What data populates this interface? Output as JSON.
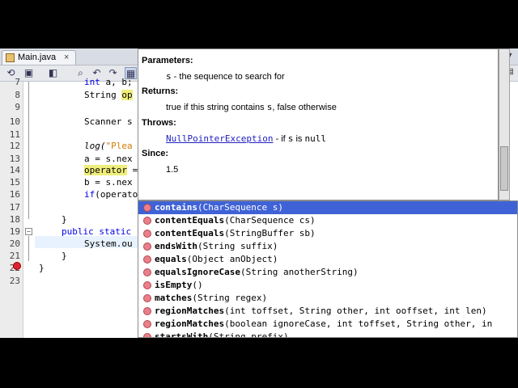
{
  "tab": {
    "label": "Main.java",
    "close": "×"
  },
  "scroll_controls": {
    "tab_list": "▾",
    "editor_split": "▤"
  },
  "toolbar_icons": [
    "history-icon",
    "source-icon",
    "back-icon",
    "forward-icon",
    "search-icon",
    "prev-icon",
    "next-icon",
    "toggle-icon"
  ],
  "gutter": {
    "line_numbers": [
      "7",
      "8",
      "9",
      "10",
      "11",
      "12",
      "13",
      "14",
      "15",
      "16",
      "17",
      "18",
      "19",
      "20",
      "21",
      "22",
      "23"
    ]
  },
  "code": {
    "l7": [
      "int",
      " a, b;"
    ],
    "l8": [
      "String ",
      "op"
    ],
    "l10": "Scanner s",
    "l12": [
      "log(",
      "\"Plea"
    ],
    "l13": "a = s.nex",
    "l14": [
      "operator",
      " ="
    ],
    "l15": "b = s.nex",
    "l16": [
      "if",
      "(operator.)"
    ],
    "l18": "}",
    "l19": [
      "public",
      " ",
      "static"
    ],
    "l20": "System.ou",
    "l21": "}",
    "l22": "}"
  },
  "javadoc": {
    "parameters_heading": "Parameters:",
    "param_name": "s",
    "param_desc": " - the sequence to search for",
    "returns_heading": "Returns:",
    "returns_pre": "true if this string contains ",
    "returns_s": "s",
    "returns_post": ", false otherwise",
    "throws_heading": "Throws:",
    "throws_link": "NullPointerException",
    "throws_pre": " - if ",
    "throws_s": "s",
    "throws_mid": " is ",
    "throws_null": "null",
    "since_heading": "Since:",
    "since_value": "1.5"
  },
  "completion_items": [
    {
      "name": "contains",
      "params": "(CharSequence s)",
      "selected": true
    },
    {
      "name": "contentEquals",
      "params": "(CharSequence cs)"
    },
    {
      "name": "contentEquals",
      "params": "(StringBuffer sb)"
    },
    {
      "name": "endsWith",
      "params": "(String suffix)"
    },
    {
      "name": "equals",
      "params": "(Object anObject)"
    },
    {
      "name": "equalsIgnoreCase",
      "params": "(String anotherString)"
    },
    {
      "name": "isEmpty",
      "params": "()"
    },
    {
      "name": "matches",
      "params": "(String regex)"
    },
    {
      "name": "regionMatches",
      "params": "(int toffset, String other, int ooffset, int len)"
    },
    {
      "name": "regionMatches",
      "params": "(boolean ignoreCase, int toffset, String other, in"
    },
    {
      "name": "startsWith",
      "params": "(String prefix)"
    }
  ],
  "colors": {
    "selection": "#3f62d6",
    "keyword": "#0000e6",
    "string": "#ce7b00",
    "highlight": "#f0ee7c",
    "method_dot": "#e8808a"
  }
}
